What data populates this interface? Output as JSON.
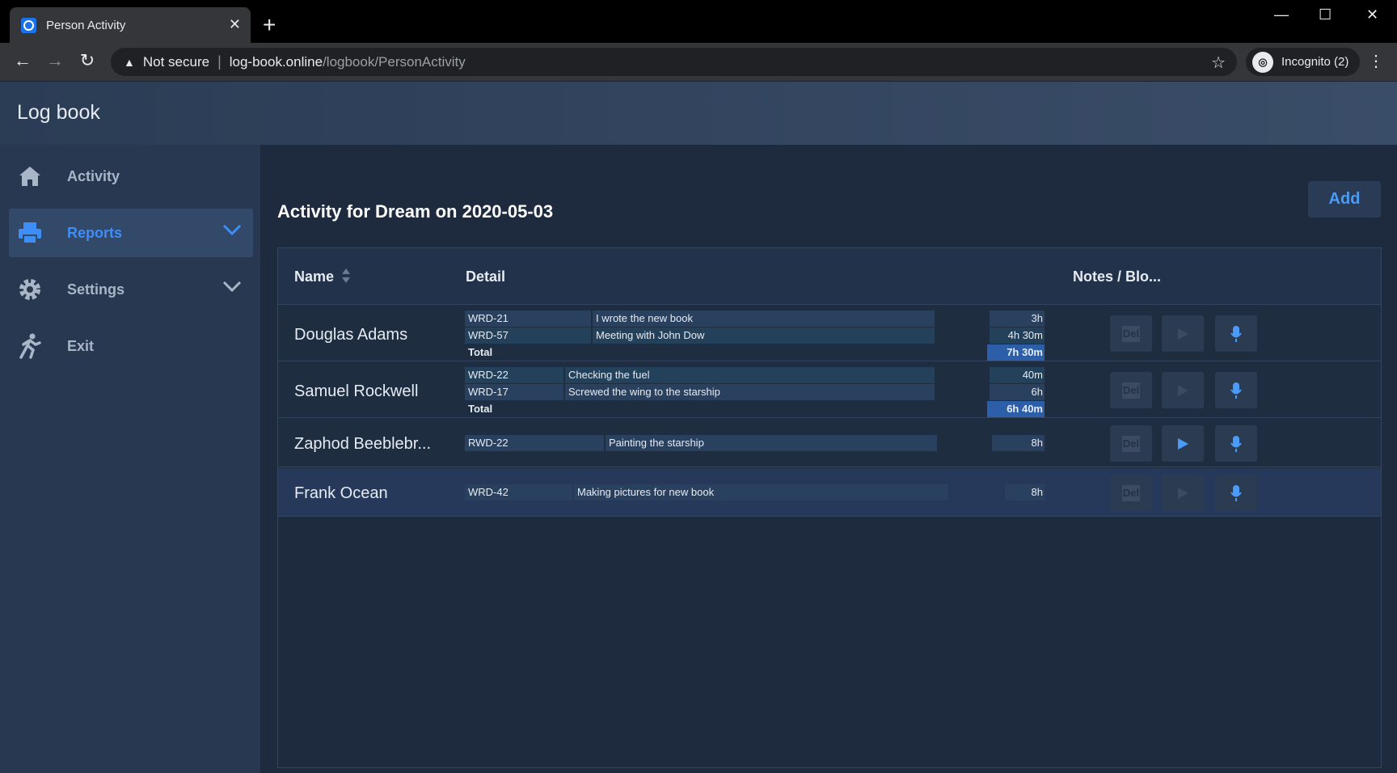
{
  "browser": {
    "tab_title": "Person Activity",
    "new_tab": "+",
    "security": "Not secure",
    "url_host": "log-book.online",
    "url_path": "/logbook/PersonActivity",
    "incognito": "Incognito (2)"
  },
  "app": {
    "brand": "Log book"
  },
  "sidebar": {
    "items": [
      {
        "label": "Activity",
        "icon": "home-icon"
      },
      {
        "label": "Reports",
        "icon": "printer-icon",
        "active": true
      },
      {
        "label": "Settings",
        "icon": "gear-icon"
      },
      {
        "label": "Exit",
        "icon": "running-person-icon"
      }
    ]
  },
  "main": {
    "title": "Activity for Dream on 2020-05-03",
    "add_label": "Add",
    "columns": {
      "name": "Name",
      "detail": "Detail",
      "notes": "Notes / Blo..."
    },
    "rows": [
      {
        "name": "Douglas Adams",
        "entries": [
          {
            "code": "WRD-21",
            "desc": "I wrote the new book",
            "dur": "3h"
          },
          {
            "code": "WRD-57",
            "desc": "Meeting with John Dow",
            "dur": "4h 30m"
          }
        ],
        "total_label": "Total",
        "total": "7h 30m"
      },
      {
        "name": "Samuel Rockwell",
        "entries": [
          {
            "code": "WRD-22",
            "desc": "Checking the fuel",
            "dur": "40m"
          },
          {
            "code": "WRD-17",
            "desc": "Screwed the wing to the starship",
            "dur": "6h"
          }
        ],
        "total_label": "Total",
        "total": "6h 40m"
      },
      {
        "name": "Zaphod Beeblebr...",
        "entries": [
          {
            "code": "RWD-22",
            "desc": "Painting the starship",
            "dur": "8h"
          }
        ]
      },
      {
        "name": "Frank Ocean",
        "entries": [
          {
            "code": "WRD-42",
            "desc": "Making pictures for new book",
            "dur": "8h"
          }
        ]
      }
    ],
    "del_label": "Del"
  },
  "colors": {
    "accent": "#3e8ef7",
    "total_bg": "#2d5fa8",
    "bg": "#1e2b3e"
  }
}
